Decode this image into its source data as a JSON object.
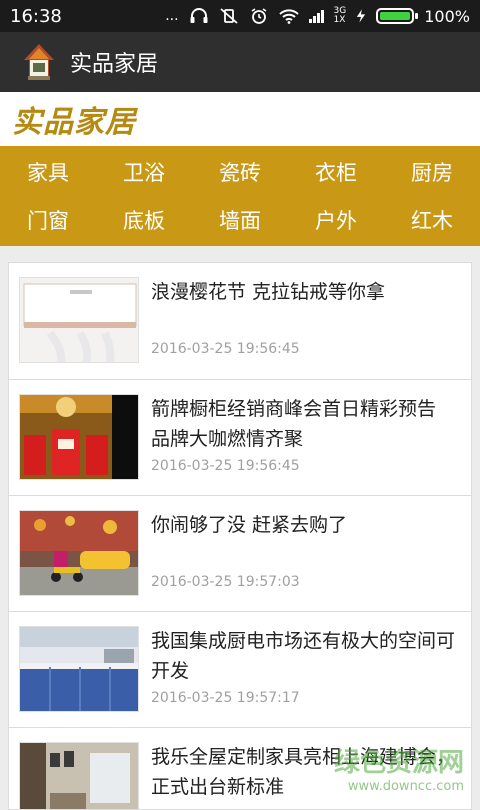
{
  "status": {
    "time": "16:38",
    "dots": "...",
    "network": "3G",
    "network_sub": "1X",
    "battery_pct": "100%",
    "battery_level": 1.0
  },
  "app": {
    "title": "实品家居"
  },
  "brand": {
    "title": "实品家居"
  },
  "categories": [
    {
      "label": "家具"
    },
    {
      "label": "卫浴"
    },
    {
      "label": "瓷砖"
    },
    {
      "label": "衣柜"
    },
    {
      "label": "厨房"
    },
    {
      "label": "门窗"
    },
    {
      "label": "底板"
    },
    {
      "label": "墙面"
    },
    {
      "label": "户外"
    },
    {
      "label": "红木"
    }
  ],
  "news": [
    {
      "title": "浪漫樱花节 克拉钻戒等你拿",
      "date": "2016-03-25 19:56:45"
    },
    {
      "title": "箭牌橱柜经销商峰会首日精彩预告 品牌大咖燃情齐聚",
      "date": "2016-03-25 19:56:45"
    },
    {
      "title": "你闹够了没 赶紧去购了",
      "date": "2016-03-25 19:57:03"
    },
    {
      "title": "我国集成厨电市场还有极大的空间可开发",
      "date": "2016-03-25 19:57:17"
    },
    {
      "title": "我乐全屋定制家具亮相上海建博会，正式出台新标准",
      "date": ""
    }
  ],
  "watermark": {
    "main": "绿色资源网",
    "url": "www.downcc.com"
  },
  "colors": {
    "accent": "#c99814",
    "brand_text": "#b58a12",
    "app_bar": "#2f2f2f"
  }
}
